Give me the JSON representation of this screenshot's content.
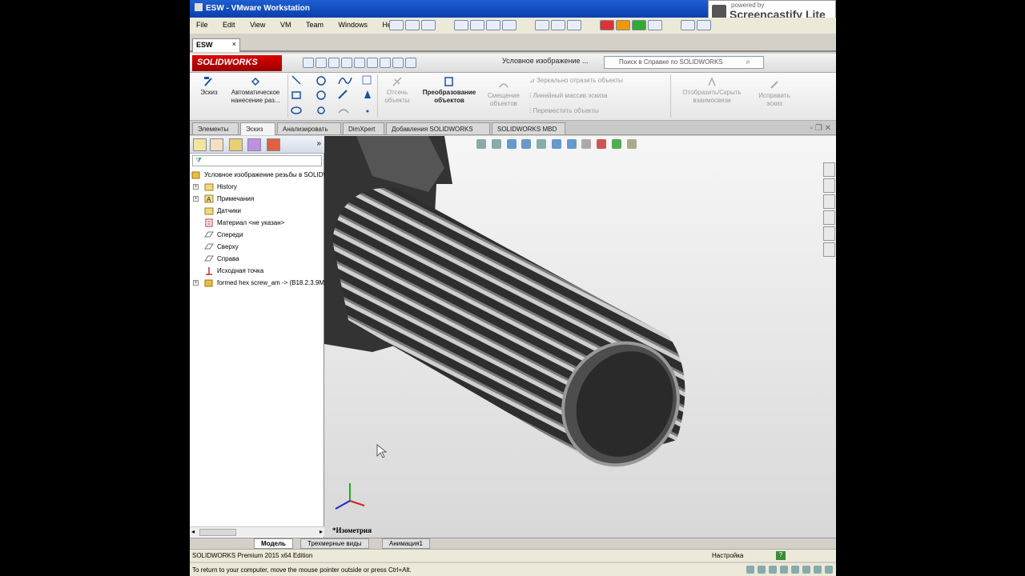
{
  "vm": {
    "title": "ESW - VMware Workstation",
    "menu": [
      "File",
      "Edit",
      "View",
      "VM",
      "Team",
      "Windows",
      "Help"
    ],
    "tab": "ESW"
  },
  "screencastify": {
    "line1": "powered by",
    "line2": "Screencastify Lite"
  },
  "solidworks": {
    "logo": "SOLIDWORKS",
    "doc_title": "Условное изображение ...",
    "search_placeholder": "Поиск в Справке по SOLIDWORKS"
  },
  "ribbon": {
    "sketch": "Эскиз",
    "smart_dim_1": "Автоматическое",
    "smart_dim_2": "нанесение раз...",
    "trim_1": "Отсечь",
    "trim_2": "объекты",
    "convert_1": "Преобразование",
    "convert_2": "объектов",
    "offset_1": "Смещение",
    "offset_2": "объектов",
    "mirror": "Зеркально отразить объекты",
    "linear": "Линейный массив эскиза",
    "move": "Переместить объекты",
    "display_1": "Отобразить/Скрыть",
    "display_2": "взаимосвязи",
    "repair_1": "Исправить",
    "repair_2": "эскиз"
  },
  "cm_tabs": [
    "Элементы",
    "Эскиз",
    "Анализировать",
    "DimXpert",
    "Добавления SOLIDWORKS",
    "SOLIDWORKS MBD"
  ],
  "tree": {
    "root": "Условное изображение резьбы в SOLIDWORKS",
    "items": [
      {
        "label": "History",
        "expand": "+"
      },
      {
        "label": "Примечания",
        "expand": "+"
      },
      {
        "label": "Датчики",
        "expand": ""
      },
      {
        "label": "Материал <не указан>",
        "expand": ""
      },
      {
        "label": "Спереди",
        "expand": ""
      },
      {
        "label": "Сверху",
        "expand": ""
      },
      {
        "label": "Справа",
        "expand": ""
      },
      {
        "label": "Исходная точка",
        "expand": ""
      },
      {
        "label": "formed hex screw_am -> (B18.2.3.9M...",
        "expand": "+"
      }
    ]
  },
  "viewport": {
    "view_label": "*Изометрия"
  },
  "bottom_tabs": [
    "Модель",
    "Трехмерные виды",
    "Анимация1"
  ],
  "status": {
    "left": "SOLIDWORKS Premium 2015 x64 Edition",
    "right": "Настройка",
    "help": "?"
  },
  "hint": "To return to your computer, move the mouse pointer outside or press Ctrl+Alt.",
  "colors": {
    "vm_title": "#0a3fae",
    "sw_red": "#cc0000",
    "bolt_dark": "#2c2c2c"
  }
}
